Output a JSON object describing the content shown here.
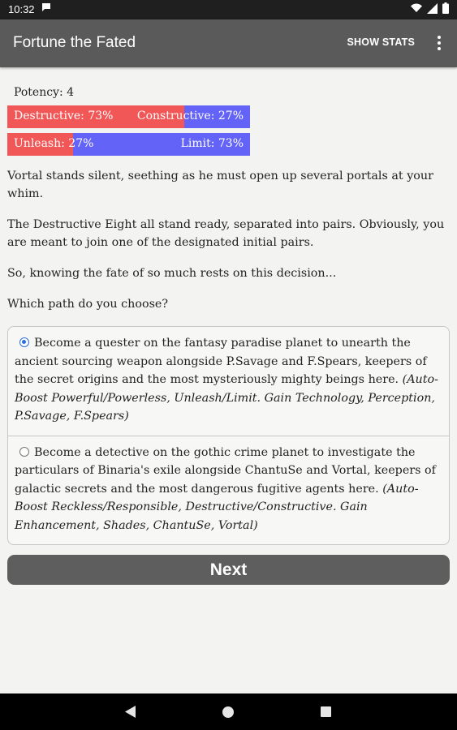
{
  "status_bar": {
    "time": "10:32",
    "notification_icon": "message-icon",
    "icons": [
      "wifi-icon",
      "signal-icon",
      "battery-icon"
    ]
  },
  "app_bar": {
    "title": "Fortune the Fated",
    "show_stats_label": "SHOW STATS",
    "menu_icon": "more-vert-icon"
  },
  "stats": {
    "potency_label": "Potency: 4",
    "bars": [
      {
        "left_label": "Destructive: 73%",
        "right_label": "Constructive: 27%",
        "left_fraction": 0.73,
        "left_color": "#f25757",
        "right_color": "#6363f7"
      },
      {
        "left_label": "Unleash: 27%",
        "right_label": "Limit: 73%",
        "left_fraction": 0.27,
        "left_color": "#f25757",
        "right_color": "#6363f7"
      }
    ]
  },
  "story": {
    "paragraphs": [
      "Vortal stands silent, seething as he must open up several portals at your whim.",
      "The Destructive Eight all stand ready, separated into pairs. Obviously, you are meant to join one of the designated initial pairs.",
      "So, knowing the fate of so much rests on this decision...",
      "Which path do you choose?"
    ]
  },
  "choices": [
    {
      "selected": true,
      "text": "Become a quester on the fantasy paradise planet to unearth the ancient sourcing weapon alongside P.Savage and F.Spears, keepers of the secret origins and the most mysteriously mighty beings here.",
      "note": "(Auto-Boost Powerful/Powerless, Unleash/Limit. Gain Technology, Perception, P.Savage, F.Spears)"
    },
    {
      "selected": false,
      "text": "Become a detective on the gothic crime planet to investigate the particulars of Binaria's exile alongside ChantuSe and Vortal, keepers of galactic secrets and the most dangerous fugitive agents here.",
      "note": "(Auto-Boost Reckless/Responsible, Destructive/Constructive. Gain Enhancement, Shades, ChantuSe, Vortal)"
    }
  ],
  "next_label": "Next",
  "nav_bar": {
    "icons": [
      "back-icon",
      "home-icon",
      "recents-icon"
    ]
  }
}
